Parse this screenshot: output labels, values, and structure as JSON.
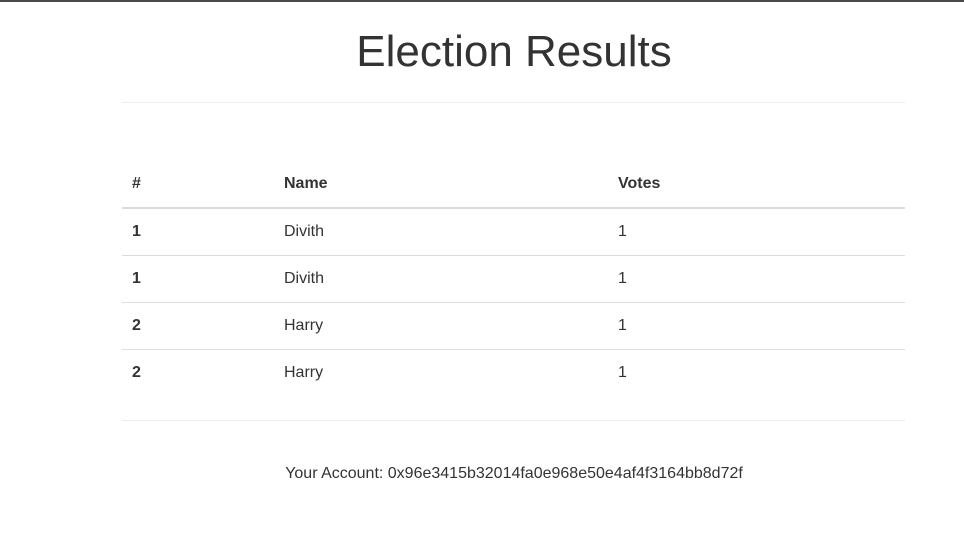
{
  "page": {
    "title": "Election Results"
  },
  "table": {
    "headers": {
      "index": "#",
      "name": "Name",
      "votes": "Votes"
    },
    "rows": [
      {
        "index": "1",
        "name": "Divith",
        "votes": "1"
      },
      {
        "index": "1",
        "name": "Divith",
        "votes": "1"
      },
      {
        "index": "2",
        "name": "Harry",
        "votes": "1"
      },
      {
        "index": "2",
        "name": "Harry",
        "votes": "1"
      }
    ]
  },
  "account": {
    "text": "Your Account: 0x96e3415b32014fa0e968e50e4af4f3164bb8d72f"
  }
}
